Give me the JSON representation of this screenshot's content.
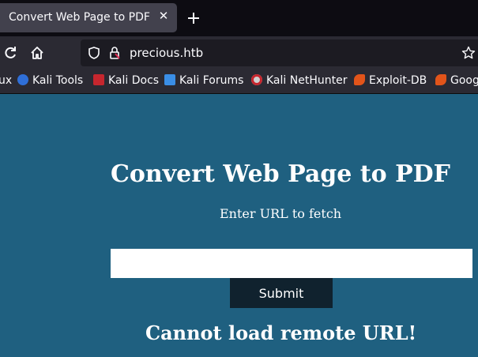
{
  "tab": {
    "title": "Convert Web Page to PDF",
    "close_icon": "close-icon",
    "new_tab_icon": "plus-icon"
  },
  "navbar": {
    "url": "precious.htb",
    "icons": [
      "reload-icon",
      "home-icon",
      "shield-icon",
      "lock-icon",
      "star-icon"
    ]
  },
  "bookmarks": {
    "items": [
      {
        "label": "ux",
        "icon": "none"
      },
      {
        "label": "Kali Tools",
        "icon": "kali-tools-icon"
      },
      {
        "label": "Kali Docs",
        "icon": "kali-docs-icon"
      },
      {
        "label": "Kali Forums",
        "icon": "kali-forums-icon"
      },
      {
        "label": "Kali NetHunter",
        "icon": "kali-nethunter-icon"
      },
      {
        "label": "Exploit-DB",
        "icon": "exploit-db-icon"
      },
      {
        "label": "Goog",
        "icon": "google-hacking-db-icon"
      }
    ]
  },
  "page": {
    "title": "Convert Web Page to PDF",
    "subtitle": "Enter URL to fetch",
    "input_value": "",
    "submit_label": "Submit",
    "error": "Cannot load remote URL!"
  },
  "colors": {
    "page_background": "#1f6080",
    "button_background": "#10222e",
    "tab_background": "#42414d",
    "toolbar_background": "#2b2a33"
  }
}
